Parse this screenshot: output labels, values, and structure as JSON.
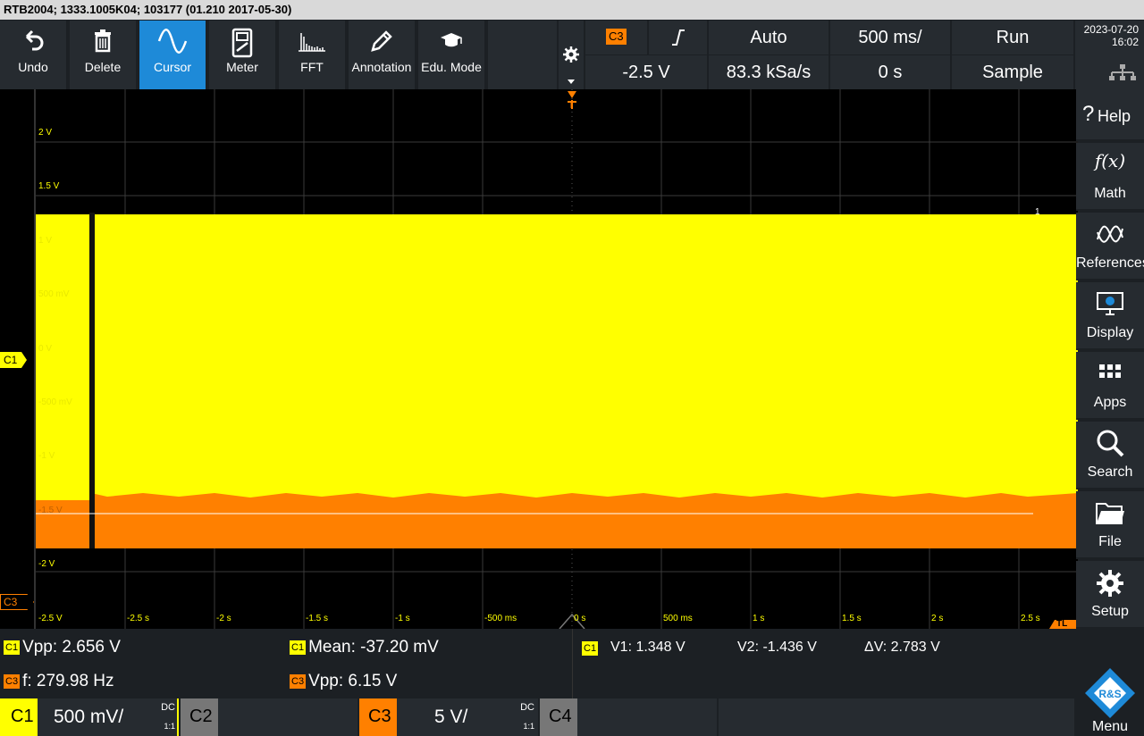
{
  "title": "RTB2004; 1333.1005K04; 103177 (01.210 2017-05-30)",
  "toolbar": [
    {
      "label": "Undo",
      "icon": "undo-icon"
    },
    {
      "label": "Delete",
      "icon": "trash-icon"
    },
    {
      "label": "Cursor",
      "icon": "cursor-wave-icon",
      "active": true
    },
    {
      "label": "Meter",
      "icon": "meter-icon"
    },
    {
      "label": "FFT",
      "icon": "fft-icon"
    },
    {
      "label": "Annotation",
      "icon": "pencil-icon"
    },
    {
      "label": "Edu. Mode",
      "icon": "graduation-cap-icon"
    }
  ],
  "header": {
    "trigger_source": "C3",
    "trigger_slope": "rising-edge",
    "trigger_mode": "Auto",
    "timebase": "500 ms/",
    "run_state": "Run",
    "trigger_level": "-2.5 V",
    "sample_rate": "83.3 kSa/s",
    "time_offset": "0 s",
    "acq_mode": "Sample",
    "date": "2023-07-20",
    "time": "16:02"
  },
  "sidebar": [
    {
      "label": "Help",
      "icon": "help-icon",
      "glyph": "?"
    },
    {
      "label": "Math",
      "icon": "function-icon",
      "glyph": "f(x)"
    },
    {
      "label": "References",
      "icon": "references-icon"
    },
    {
      "label": "Display",
      "icon": "display-icon"
    },
    {
      "label": "Apps",
      "icon": "apps-grid-icon"
    },
    {
      "label": "Search",
      "icon": "search-icon"
    },
    {
      "label": "File",
      "icon": "folder-icon"
    },
    {
      "label": "Setup",
      "icon": "gear-icon"
    }
  ],
  "grid": {
    "y_labels": [
      "2 V",
      "1.5 V",
      "1 V",
      "500 mV",
      "0 V",
      "-500 mV",
      "-1 V",
      "-1.5 V",
      "-2 V",
      "-2.5 V"
    ],
    "x_labels": [
      "-2.5 s",
      "-2 s",
      "-1.5 s",
      "-1 s",
      "-500 ms",
      "0 s",
      "500 ms",
      "1 s",
      "1.5 s",
      "2 s",
      "2.5 s"
    ],
    "c1_marker": "C1",
    "c3_marker": "C3",
    "trigger_marker": "T",
    "level_marker": "TL",
    "cursor_marker": "1"
  },
  "measurements": {
    "m1": {
      "ch": "C1",
      "text": "Vpp: 2.656 V"
    },
    "m2": {
      "ch": "C1",
      "text": "Mean: -37.20 mV"
    },
    "m3": {
      "ch": "C3",
      "text": "f: 279.98 Hz"
    },
    "m4": {
      "ch": "C3",
      "text": "Vpp: 6.15 V"
    },
    "cursor": {
      "ch": "C1",
      "v1": "V1: 1.348 V",
      "v2": "V2: -1.436 V",
      "dv": "ΔV: 2.783 V"
    }
  },
  "channels": {
    "c1": {
      "label": "C1",
      "scale": "500 mV/",
      "coupling": "DC",
      "probe": "1:1",
      "color": "#ffff00"
    },
    "c2": {
      "label": "C2"
    },
    "c3": {
      "label": "C3",
      "scale": "5 V/",
      "coupling": "DC",
      "probe": "1:1",
      "color": "#ff8000"
    },
    "c4": {
      "label": "C4"
    }
  },
  "menu": {
    "label": "Menu",
    "logo": "R&S"
  }
}
